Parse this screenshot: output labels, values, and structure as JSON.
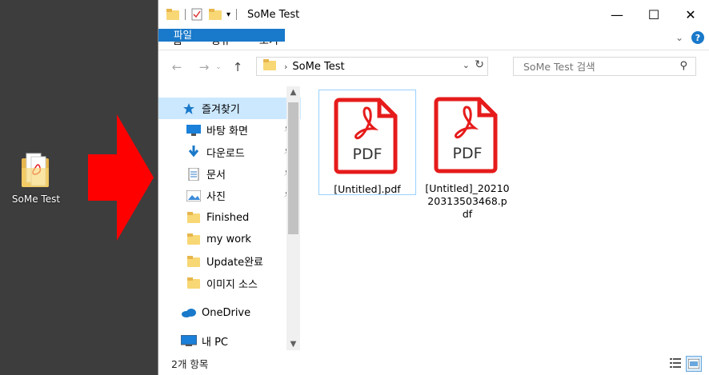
{
  "desktop": {
    "folder_label": "SoMe Test"
  },
  "window": {
    "title": "SoMe Test"
  },
  "ribbon": {
    "tabs": [
      "파일",
      "홈",
      "공유",
      "보기"
    ]
  },
  "address": {
    "path": "SoMe Test",
    "search_placeholder": "SoMe Test 검색"
  },
  "navpane": {
    "items": [
      {
        "label": "즐겨찾기",
        "icon": "star-icon",
        "pinned": false
      },
      {
        "label": "바탕 화면",
        "icon": "desktop-icon",
        "pinned": true
      },
      {
        "label": "다운로드",
        "icon": "download-icon",
        "pinned": true
      },
      {
        "label": "문서",
        "icon": "document-icon",
        "pinned": true
      },
      {
        "label": "사진",
        "icon": "pictures-icon",
        "pinned": true
      },
      {
        "label": "Finished",
        "icon": "folder-icon",
        "pinned": false
      },
      {
        "label": "my work",
        "icon": "folder-icon",
        "pinned": false
      },
      {
        "label": "Update완료",
        "icon": "folder-icon",
        "pinned": false
      },
      {
        "label": "이미지 소스",
        "icon": "folder-icon",
        "pinned": false
      },
      {
        "label": "OneDrive",
        "icon": "cloud-icon",
        "pinned": false
      },
      {
        "label": "내 PC",
        "icon": "pc-icon",
        "pinned": false
      }
    ]
  },
  "files": [
    {
      "name": "[Untitled].pdf",
      "badge": "PDF",
      "selected": true
    },
    {
      "name": "[Untitled]_20210203135034 68.pdf",
      "badge": "PDF",
      "selected": false
    }
  ],
  "file_lines": [
    [
      "[Untitled].pdf"
    ],
    [
      "[Untitled]_20210",
      "20313503468.p",
      "df"
    ]
  ],
  "status": {
    "count": "2개 항목"
  },
  "colors": {
    "accent": "#1979ca",
    "pdf_red": "#e61b1b",
    "selection": "#cce8ff",
    "folder": "#f8d775"
  }
}
